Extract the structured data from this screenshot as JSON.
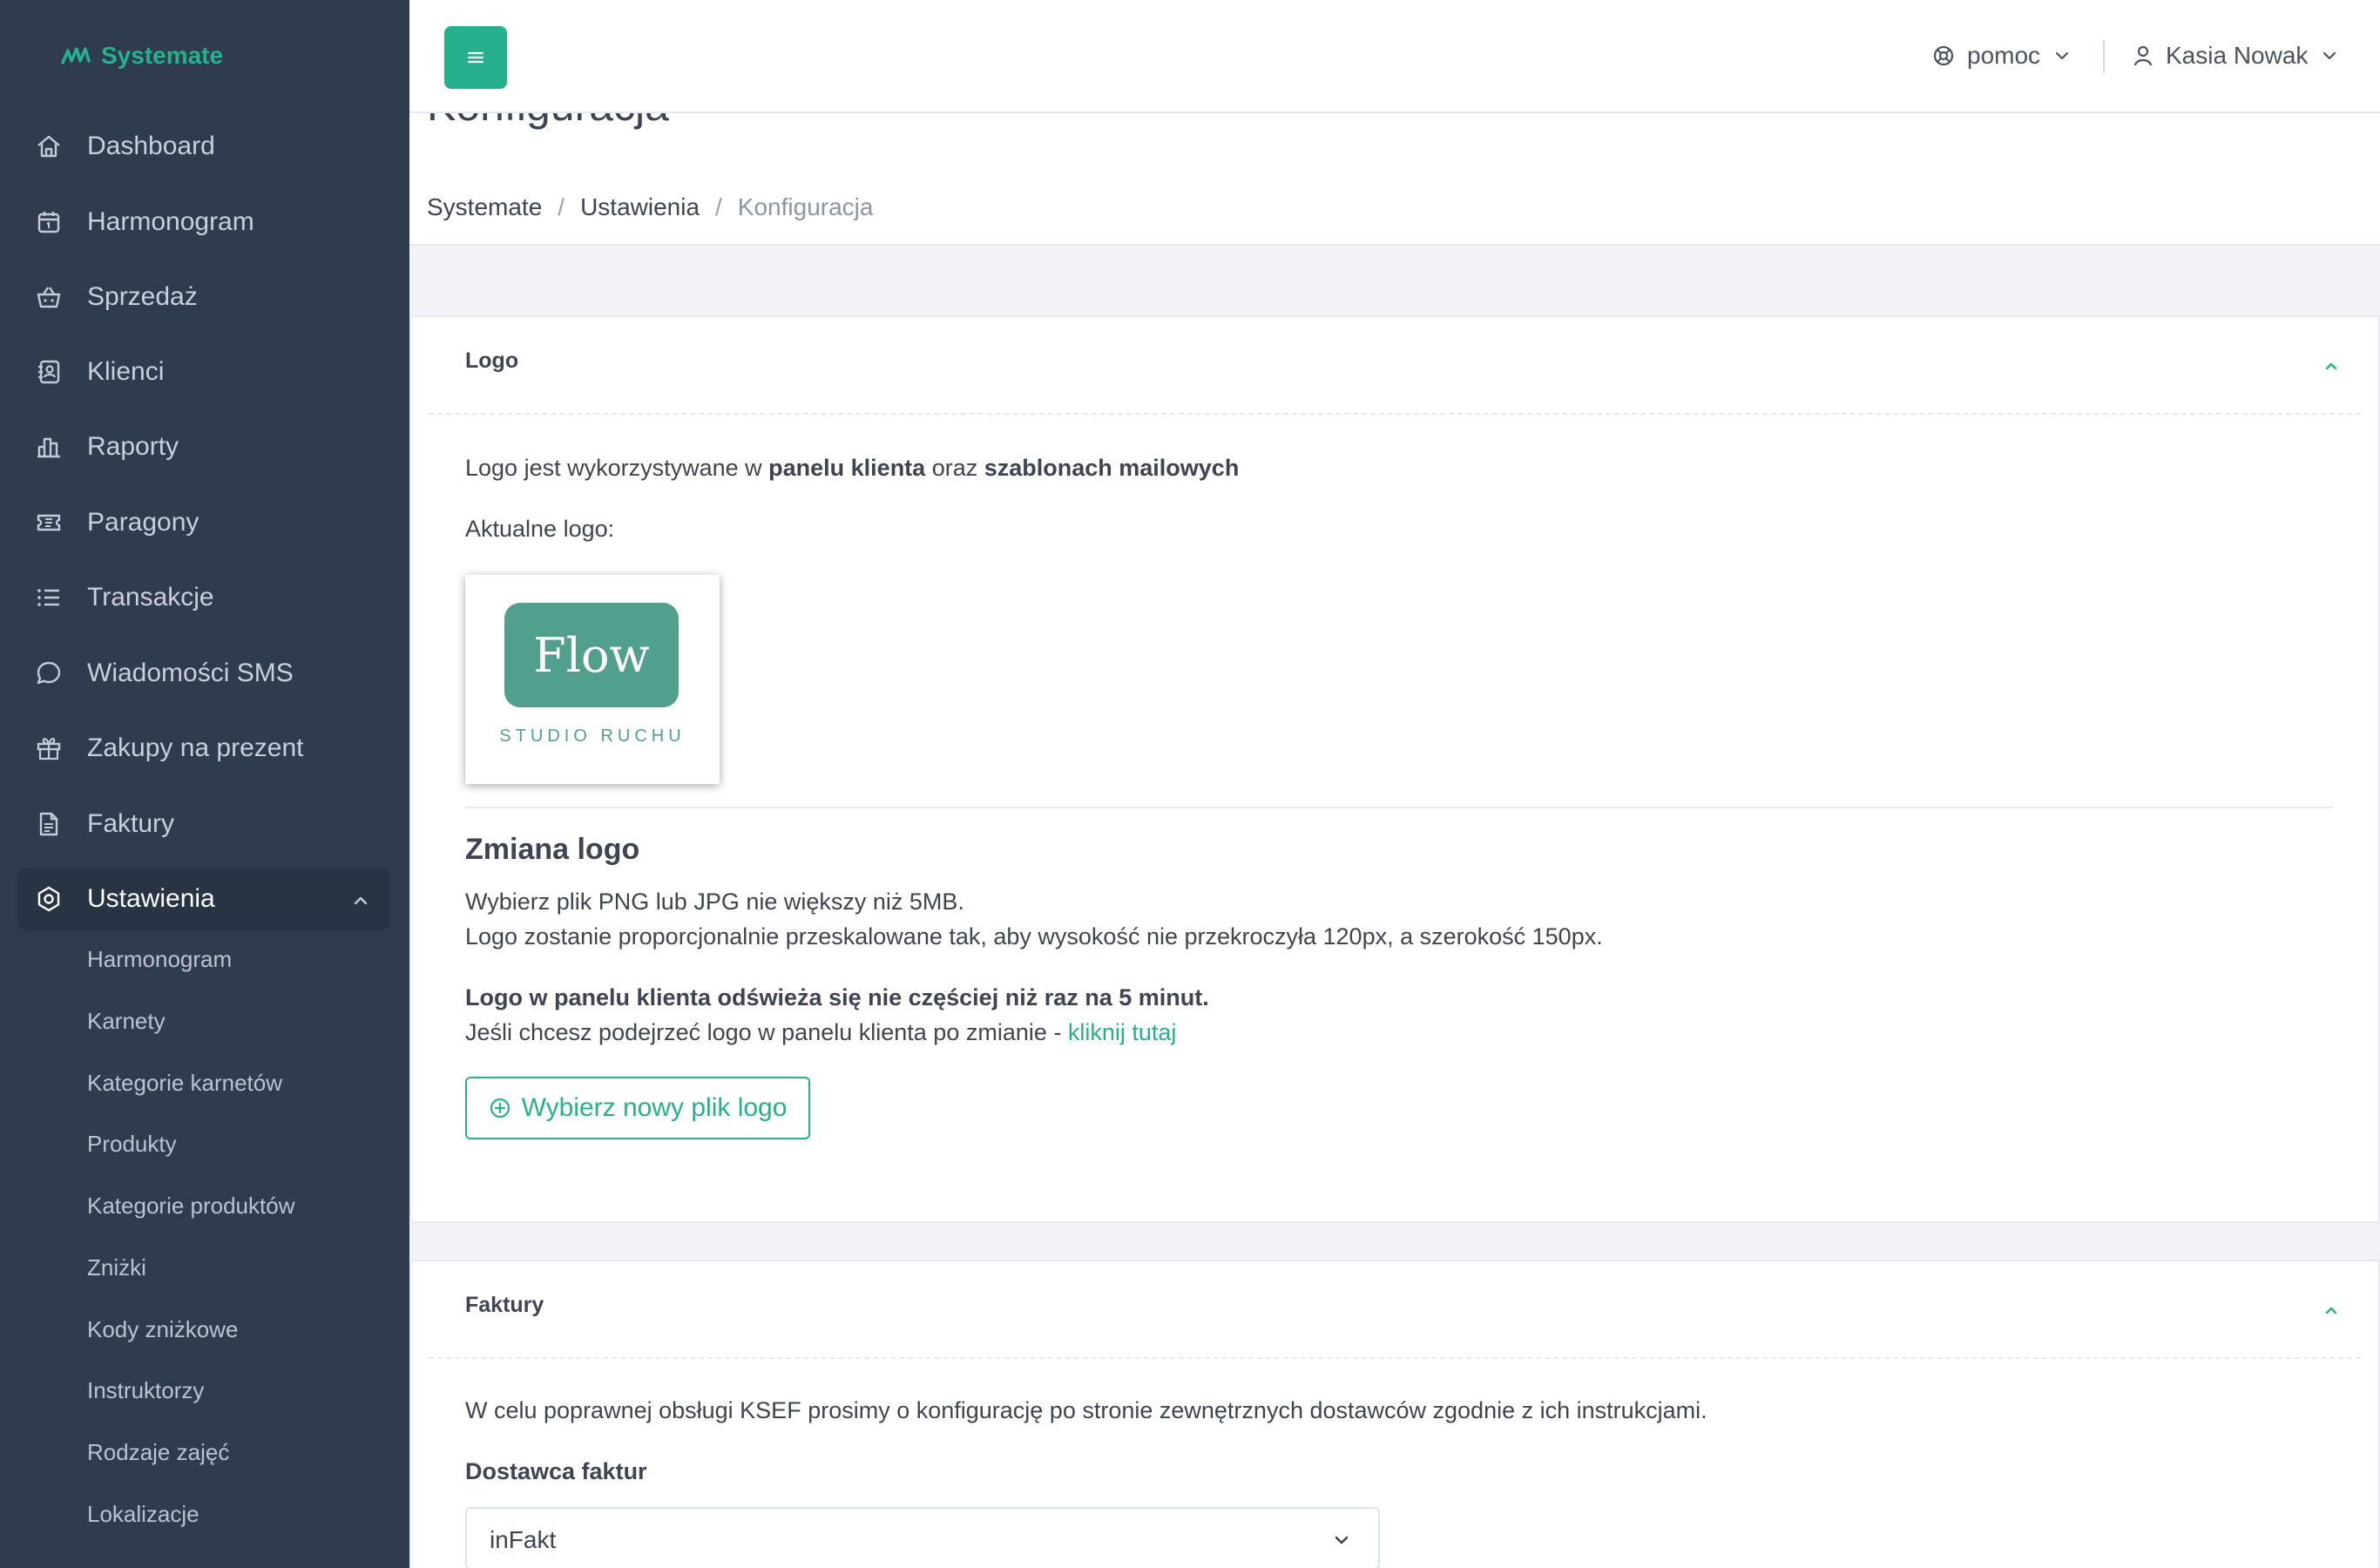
{
  "brand": {
    "name": "Systemate"
  },
  "sidebar": {
    "items": [
      {
        "label": "Dashboard",
        "icon": "home-icon"
      },
      {
        "label": "Harmonogram",
        "icon": "calendar-icon"
      },
      {
        "label": "Sprzedaż",
        "icon": "basket-icon"
      },
      {
        "label": "Klienci",
        "icon": "contacts-icon"
      },
      {
        "label": "Raporty",
        "icon": "bar-chart-icon"
      },
      {
        "label": "Paragony",
        "icon": "ticket-icon"
      },
      {
        "label": "Transakcje",
        "icon": "list-icon"
      },
      {
        "label": "Wiadomości SMS",
        "icon": "chat-icon"
      },
      {
        "label": "Zakupy na prezent",
        "icon": "gift-icon"
      },
      {
        "label": "Faktury",
        "icon": "document-icon"
      },
      {
        "label": "Ustawienia",
        "icon": "settings-icon"
      }
    ],
    "subitems": [
      "Harmonogram",
      "Karnety",
      "Kategorie karnetów",
      "Produkty",
      "Kategorie produktów",
      "Zniżki",
      "Kody zniżkowe",
      "Instruktorzy",
      "Rodzaje zajęć",
      "Lokalizacje"
    ]
  },
  "topbar": {
    "help_label": "pomoc",
    "user_name": "Kasia Nowak"
  },
  "page": {
    "title": "Konfiguracja",
    "breadcrumb": [
      "Systemate",
      "Ustawienia",
      "Konfiguracja"
    ]
  },
  "logo_card": {
    "title": "Logo",
    "intro_a": "Logo jest wykorzystywane w ",
    "intro_b": "panelu klienta",
    "intro_c": " oraz ",
    "intro_d": "szablonach mailowych",
    "current_label": "Aktualne logo:",
    "logo_text": "Flow",
    "logo_subtext": "STUDIO RUCHU",
    "change_heading": "Zmiana logo",
    "req_line1": "Wybierz plik PNG lub JPG nie większy niż 5MB.",
    "req_line2": "Logo zostanie proporcjonalnie przeskalowane tak, aby wysokość nie przekroczyła 120px, a szerokość 150px.",
    "refresh_note": "Logo w panelu klienta odświeża się nie częściej niż raz na 5 minut.",
    "preview_text": "Jeśli chcesz podejrzeć logo w panelu klienta po zmianie - ",
    "preview_link": "kliknij tutaj",
    "upload_button": "Wybierz nowy plik logo"
  },
  "invoice_card": {
    "title": "Faktury",
    "intro": "W celu poprawnej obsługi KSEF prosimy o konfigurację po stronie zewnętrznych dostawców zgodnie z ich instrukcjami.",
    "provider_label": "Dostawca faktur",
    "provider_value": "inFakt"
  },
  "colors": {
    "accent": "#26b08e",
    "sidebar_bg": "#2f3c4e",
    "logo_bg": "#51a08e"
  }
}
